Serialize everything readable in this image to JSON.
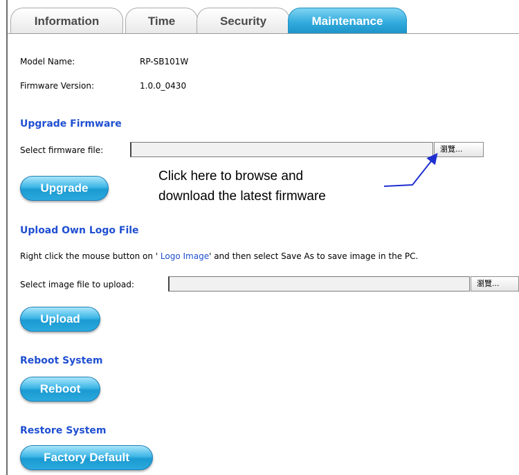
{
  "tabs": [
    {
      "label": "Information",
      "active": false
    },
    {
      "label": "Time",
      "active": false
    },
    {
      "label": "Security",
      "active": false
    },
    {
      "label": "Maintenance",
      "active": true
    }
  ],
  "info": {
    "model_label": "Model Name:",
    "model_value": "RP-SB101W",
    "firmware_label": "Firmware Version:",
    "firmware_value": "1.0.0_0430"
  },
  "upgrade": {
    "title": "Upgrade Firmware",
    "select_label": "Select firmware file:",
    "file_value": "",
    "browse_label": "瀏覽...",
    "button_label": "Upgrade"
  },
  "annotation": {
    "line1": "Click here to browse and",
    "line2": "download the latest firmware"
  },
  "logo": {
    "title": "Upload Own Logo File",
    "instruction_before": "Right click the mouse button on ' ",
    "link_text": "Logo Image",
    "instruction_after": "' and then select Save As to save image in the PC.",
    "select_label": "Select image file to upload:",
    "file_value": "",
    "browse_label": "瀏覽...",
    "button_label": "Upload"
  },
  "reboot": {
    "title": "Reboot System",
    "button_label": "Reboot"
  },
  "restore": {
    "title": "Restore System",
    "button_label": "Factory Default"
  },
  "colors": {
    "section_title": "#1f4fd1",
    "tab_active": "#2fa9dc",
    "button": "#2aa9df",
    "arrow": "#1e2fd0"
  }
}
